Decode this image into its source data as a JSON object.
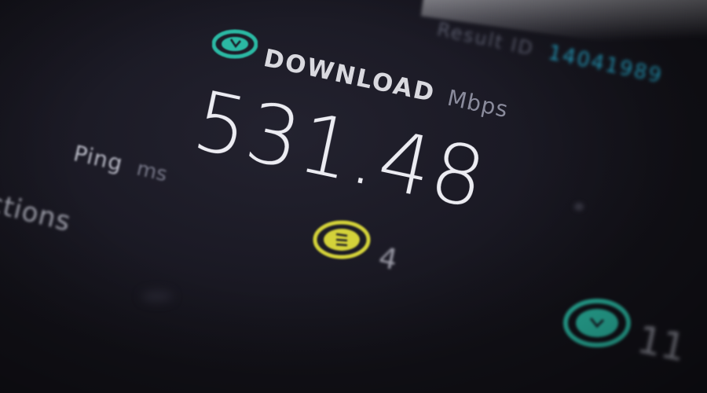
{
  "result": {
    "label": "Result ID",
    "value": "14041989"
  },
  "download": {
    "title": "DOWNLOAD",
    "unit": "Mbps",
    "value": "531.48",
    "icon": "download-arrow-icon",
    "accent": "#2bb8a3"
  },
  "ping": {
    "label": "Ping",
    "unit": "ms",
    "value": "4",
    "icon": "ping-icon",
    "accent": "#d4d23a"
  },
  "connections": {
    "label": "ctions"
  },
  "upload": {
    "value": "11",
    "icon": "upload-arrow-icon",
    "accent": "#2bb8a3"
  }
}
